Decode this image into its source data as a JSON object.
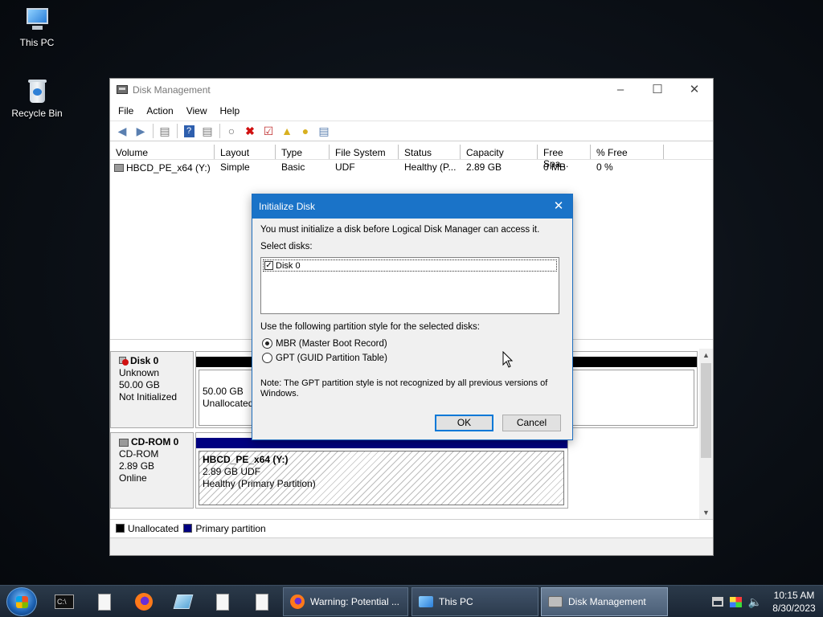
{
  "desktop": {
    "icons": [
      {
        "label": "This PC"
      },
      {
        "label": "Recycle Bin"
      }
    ]
  },
  "window": {
    "title": "Disk Management",
    "menu": [
      "File",
      "Action",
      "View",
      "Help"
    ],
    "volume_table": {
      "columns": [
        "Volume",
        "Layout",
        "Type",
        "File System",
        "Status",
        "Capacity",
        "Free Spa...",
        "% Free"
      ],
      "rows": [
        {
          "volume": "HBCD_PE_x64 (Y:)",
          "layout": "Simple",
          "type": "Basic",
          "fs": "UDF",
          "status": "Healthy (P...",
          "capacity": "2.89 GB",
          "free": "0 MB",
          "pct_free": "0 %"
        }
      ]
    },
    "disks": [
      {
        "name": "Disk 0",
        "type": "Unknown",
        "size": "50.00 GB",
        "state": "Not Initialized",
        "part_size": "50.00 GB",
        "part_state": "Unallocated"
      },
      {
        "name": "CD-ROM 0",
        "type": "CD-ROM",
        "size": "2.89 GB",
        "state": "Online",
        "part_name": "HBCD_PE_x64  (Y:)",
        "part_fs": "2.89 GB UDF",
        "part_health": "Healthy (Primary Partition)"
      }
    ],
    "legend": [
      {
        "label": "Unallocated",
        "color": "#000000"
      },
      {
        "label": "Primary partition",
        "color": "#000080"
      }
    ]
  },
  "dialog": {
    "title": "Initialize Disk",
    "message": "You must initialize a disk before Logical Disk Manager can access it.",
    "select_label": "Select disks:",
    "disk_item": "Disk 0",
    "disk_checked": true,
    "style_label": "Use the following partition style for the selected disks:",
    "options": [
      {
        "label": "MBR (Master Boot Record)",
        "selected": true
      },
      {
        "label": "GPT (GUID Partition Table)",
        "selected": false
      }
    ],
    "note_line1": "Note: The GPT partition style is not recognized by all previous versions of",
    "note_line2": "Windows.",
    "ok_label": "OK",
    "cancel_label": "Cancel"
  },
  "taskbar": {
    "tasks": [
      {
        "label": "Warning: Potential ..."
      },
      {
        "label": "This PC"
      },
      {
        "label": "Disk Management"
      }
    ],
    "time": "10:15 AM",
    "date": "8/30/2023"
  }
}
